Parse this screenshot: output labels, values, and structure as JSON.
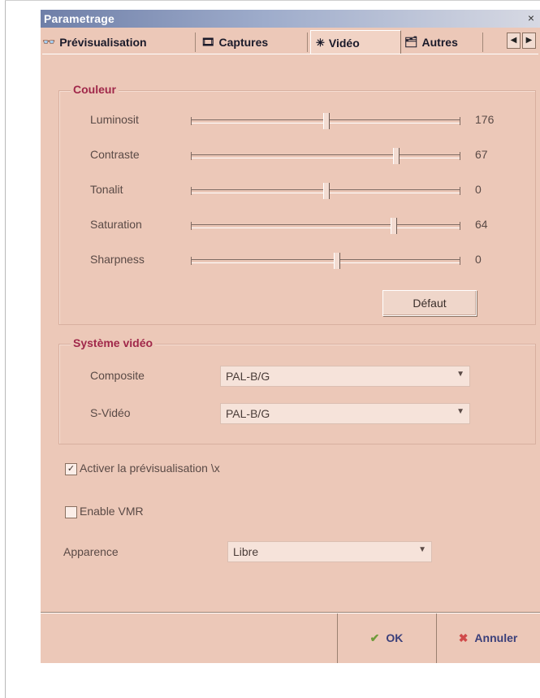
{
  "window": {
    "title": "Parametrage",
    "close_glyph": "×"
  },
  "tabs": [
    {
      "label": "Prévisualisation",
      "icon": "eyeglasses-icon",
      "glyph": "👓"
    },
    {
      "label": "Captures",
      "icon": "film-icon",
      "glyph": "🎞"
    },
    {
      "label": "Vidéo",
      "icon": "video-icon",
      "glyph": "✳",
      "active": true
    },
    {
      "label": "Autres",
      "icon": "tools-icon",
      "glyph": "🗂"
    }
  ],
  "tab_scroll": {
    "left_glyph": "◀",
    "right_glyph": "▶"
  },
  "couleur": {
    "title": "Couleur",
    "sliders": [
      {
        "label": "Luminosit",
        "value": "176",
        "level": 0.5
      },
      {
        "label": "Contraste",
        "value": "67",
        "level": 0.76
      },
      {
        "label": "Tonalit",
        "value": "0",
        "level": 0.5
      },
      {
        "label": "Saturation",
        "value": "64",
        "level": 0.75
      },
      {
        "label": "Sharpness",
        "value": "0",
        "level": 0.54
      }
    ],
    "default_button": "Défaut"
  },
  "systeme_video": {
    "title": "Système vidéo",
    "rows": [
      {
        "label": "Composite",
        "value": "PAL-B/G"
      },
      {
        "label": "S-Vidéo",
        "value": "PAL-B/G"
      }
    ]
  },
  "options": {
    "preview_checkbox": {
      "label": "Activer la prévisualisation \\x",
      "checked": true,
      "mark": "✓"
    },
    "vmr_checkbox": {
      "label": "Enable VMR",
      "checked": false,
      "mark": ""
    }
  },
  "appearance": {
    "label": "Apparence",
    "value": "Libre"
  },
  "footer": {
    "ok_label": "OK",
    "ok_glyph": "✔",
    "cancel_label": "Annuler",
    "cancel_glyph": "✖"
  },
  "colors": {
    "title_accent": "#a0284a",
    "background": "#ecc8b8",
    "ok_green": "#6f9b3a",
    "cancel_red": "#d04a4a"
  }
}
